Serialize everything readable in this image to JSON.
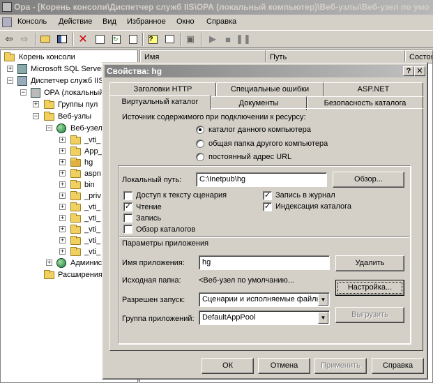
{
  "window": {
    "title": "Ора - [Корень консоли\\Диспетчер служб IIS\\ОРА (локальный компьютер)\\Веб-узлы\\Веб-узел по умо"
  },
  "menu": {
    "items": [
      "Консоль",
      "Действие",
      "Вид",
      "Избранное",
      "Окно",
      "Справка"
    ]
  },
  "toolbar": {
    "icons": [
      "back-icon",
      "forward-icon",
      "up-folder-icon",
      "show-tree-icon",
      "delete-icon",
      "properties-icon",
      "refresh-icon",
      "export-icon",
      "help-icon",
      "console-icon",
      "computer-icon",
      "play-icon",
      "stop-icon",
      "pause-icon"
    ]
  },
  "tree": {
    "root": "Корень консоли",
    "items": [
      {
        "label": "Microsoft SQL Server"
      },
      {
        "label": "Диспетчер служб IIS"
      },
      {
        "label": "ОРА (локальный"
      },
      {
        "label": "Группы пул"
      },
      {
        "label": "Веб-узлы"
      },
      {
        "label": "Веб-узел"
      },
      {
        "label": "_vti_"
      },
      {
        "label": "App_"
      },
      {
        "label": "hg"
      },
      {
        "label": "aspn"
      },
      {
        "label": "bin"
      },
      {
        "label": "_priv"
      },
      {
        "label": "_vti_"
      },
      {
        "label": "_vti_"
      },
      {
        "label": "_vti_"
      },
      {
        "label": "_vti_"
      },
      {
        "label": "_vti_"
      },
      {
        "label": "Админис"
      },
      {
        "label": "Расширения"
      }
    ]
  },
  "list": {
    "columns": [
      "Имя",
      "Путь",
      "Состоя"
    ]
  },
  "dialog": {
    "title": "Свойства: hg",
    "help_button": "?",
    "close_button": "✕",
    "tabs_row1": [
      "Заголовки HTTP",
      "Специальные ошибки",
      "ASP.NET"
    ],
    "tabs_row2": [
      "Виртуальный каталог",
      "Документы",
      "Безопасность каталога"
    ],
    "source_label": "Источник содержимого при подключении к ресурсу:",
    "source_options": [
      {
        "label": "каталог данного компьютера",
        "selected": true
      },
      {
        "label": "общая папка другого компьютера",
        "selected": false
      },
      {
        "label": "постоянный адрес URL",
        "selected": false
      }
    ],
    "local_path_label": "Локальный путь:",
    "local_path_value": "C:\\Inetpub\\hg",
    "browse_button": "Обзор...",
    "checkboxes_left": [
      {
        "label": "Доступ к тексту сценария",
        "checked": false
      },
      {
        "label": "Чтение",
        "checked": true
      },
      {
        "label": "Запись",
        "checked": false
      },
      {
        "label": "Обзор каталогов",
        "checked": false
      }
    ],
    "checkboxes_right": [
      {
        "label": "Запись в журнал",
        "checked": true
      },
      {
        "label": "Индексация каталога",
        "checked": true
      }
    ],
    "app_settings_label": "Параметры приложения",
    "app_name_label": "Имя приложения:",
    "app_name_value": "hg",
    "remove_button": "Удалить",
    "start_folder_label": "Исходная папка:",
    "start_folder_value": "<Веб-узел по умолчанию...",
    "config_button": "Настройка...",
    "exec_perm_label": "Разрешен запуск:",
    "exec_perm_value": "Сценарии и исполняемые файлы",
    "app_pool_label": "Группа приложений:",
    "app_pool_value": "DefaultAppPool",
    "unload_button": "Выгрузить",
    "ok_button": "ОК",
    "cancel_button": "Отмена",
    "apply_button": "Применить",
    "help_button_bottom": "Справка"
  },
  "colors": {
    "window_bg": "#d4d0c8",
    "title_inactive": "#808080"
  }
}
